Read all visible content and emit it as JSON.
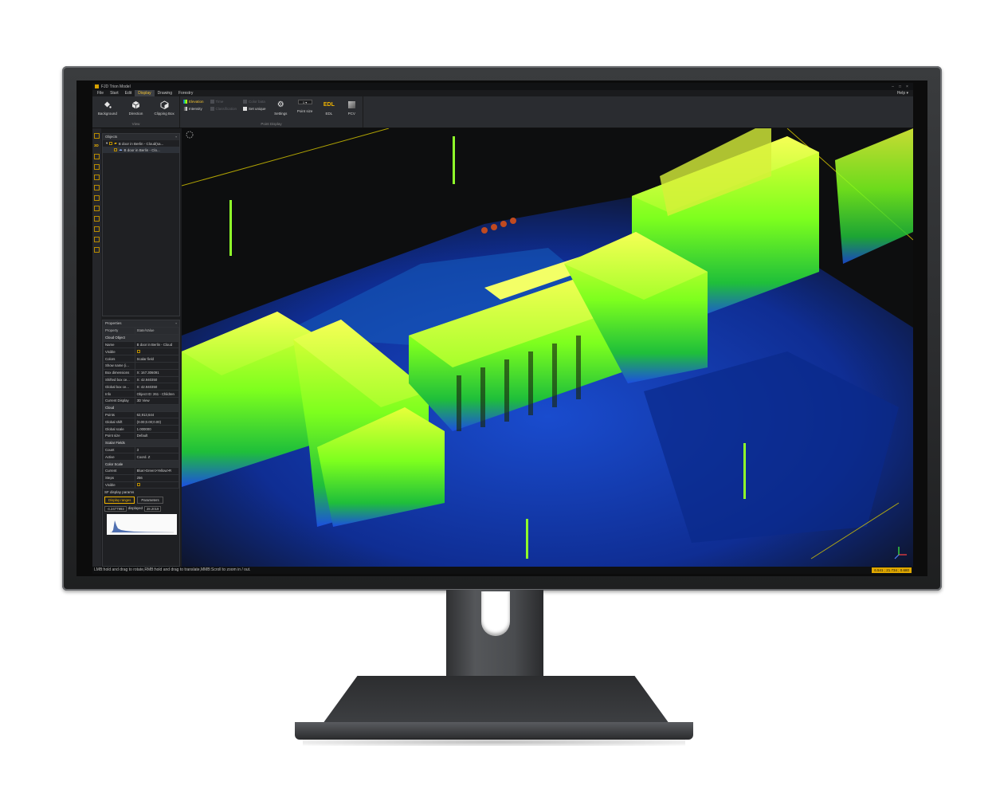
{
  "window": {
    "title": "FJD Trion Model",
    "controls": [
      "–",
      "□",
      "×"
    ]
  },
  "menu": {
    "items": [
      "File",
      "Start",
      "Edit",
      "Display",
      "Drawing",
      "Forestry"
    ],
    "active": "Display",
    "help": "Help ▾"
  },
  "ribbon": {
    "view_group": {
      "label": "View",
      "buttons": [
        {
          "label": "Background",
          "icon": "paint-bucket-icon"
        },
        {
          "label": "Direction",
          "icon": "cube-icon"
        },
        {
          "label": "Clipping Box",
          "icon": "clipping-box-icon"
        }
      ]
    },
    "point_display_group": {
      "label": "Point Display",
      "col1": [
        "Elevation",
        "Intensity"
      ],
      "col2": [
        "Time",
        "Classification"
      ],
      "col3": [
        "Color bata",
        "Set unique"
      ],
      "settings_label": "Settings",
      "point_size_value": "1",
      "point_size_label": "Point size",
      "edl_icon_text": "EDL",
      "edl_label": "EDL",
      "pcv_label": "PCV"
    }
  },
  "objects_panel": {
    "title": "Objects",
    "items": [
      "B door in Berlin - Cloud(sa...",
      "B door in Berlin - Clo..."
    ]
  },
  "properties_panel": {
    "title": "Properties",
    "columns": [
      "Property",
      "State/Value"
    ],
    "rows": [
      {
        "section": "Cloud Object"
      },
      {
        "k": "Name",
        "v": "B door in Berlin - Cloud"
      },
      {
        "k": "Visible",
        "v": ""
      },
      {
        "k": "Colors",
        "v": "Scalar field"
      },
      {
        "k": "Show name (i...",
        "v": ""
      },
      {
        "k": "Box dimensions",
        "v": "X: 167.306091"
      },
      {
        "k": "Shifted box ce...",
        "v": "X: 42.940350"
      },
      {
        "k": "Global box ce...",
        "v": "X: 42.940350"
      },
      {
        "k": "Info",
        "v": "Object ID: 261 - Children"
      },
      {
        "k": "Current Display",
        "v": "3D View"
      },
      {
        "section": "Cloud"
      },
      {
        "k": "Points",
        "v": "62,913,644"
      },
      {
        "k": "Global shift",
        "v": "(0.00;0.00;0.00)"
      },
      {
        "k": "Global scale",
        "v": "1.000000"
      },
      {
        "k": "Point size",
        "v": "Default"
      },
      {
        "section": "Scalar Fields"
      },
      {
        "k": "Count",
        "v": "3"
      },
      {
        "k": "Active",
        "v": "Coord. Z"
      },
      {
        "section": "Color Scale"
      },
      {
        "k": "Current",
        "v": "Blue>Green>Yellow>R"
      },
      {
        "k": "Steps",
        "v": "256"
      },
      {
        "k": "Visible",
        "v": ""
      }
    ],
    "sf_label": "SF display params",
    "tabs": [
      "Display ranges",
      "Parameters"
    ],
    "range_min": "-4.2477993",
    "range_mode": "displayed",
    "range_max": "28.2019"
  },
  "status": {
    "hint": "LMB:hold and drag to rotate,RMB:hold and drag to translate,MMB:Scroll to zoom in / out.",
    "coords": "6.541 ; 21.734 ; 0.680"
  }
}
